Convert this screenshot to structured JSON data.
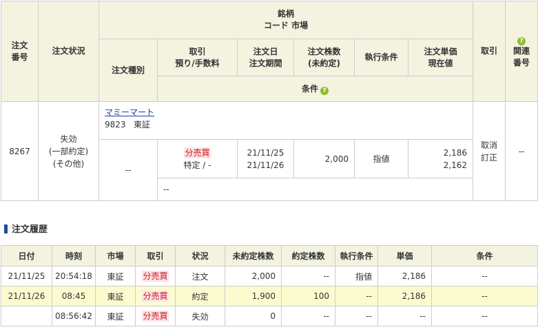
{
  "order": {
    "headers": {
      "order_no": [
        "注文",
        "番号"
      ],
      "status": "注文状況",
      "stock": "銘柄",
      "code_market": "コード 市場",
      "order_type": "注文種別",
      "trade": [
        "取引",
        "預り/手数料"
      ],
      "date": [
        "注文日",
        "注文期間"
      ],
      "qty": [
        "注文株数",
        "(未約定)"
      ],
      "exec_cond": "執行条件",
      "price": [
        "注文単価",
        "現在値"
      ],
      "action": "取引",
      "related": [
        "関連",
        "番号"
      ],
      "condition": "条件",
      "help": "?"
    },
    "row": {
      "order_no": "8267",
      "status": [
        "失効",
        "(一部約定)",
        "(その他)"
      ],
      "stock_name": "マミーマート",
      "code": "9823",
      "market": "東証",
      "order_type": "--",
      "trade_type": "分売買",
      "account": "特定 / -",
      "order_date": "21/11/25",
      "period": "21/11/26",
      "qty": "2,000",
      "exec_cond": "指値",
      "order_price": "2,186",
      "current_price": "2,162",
      "actions": [
        "取消",
        "訂正"
      ],
      "related": "--",
      "condition": "--"
    }
  },
  "history": {
    "title": "注文履歴",
    "headers": [
      "日付",
      "時刻",
      "市場",
      "取引",
      "状況",
      "未約定株数",
      "約定株数",
      "執行条件",
      "単価",
      "条件"
    ],
    "rows": [
      {
        "date": "21/11/25",
        "time": "20:54:18",
        "market": "東証",
        "trade": "分売買",
        "status": "注文",
        "unfilled": "2,000",
        "filled": "--",
        "exec": "指値",
        "price": "2,186",
        "cond": "--"
      },
      {
        "date": "21/11/26",
        "time": "08:45",
        "market": "東証",
        "trade": "分売買",
        "status": "約定",
        "unfilled": "1,900",
        "filled": "100",
        "exec": "--",
        "price": "2,186",
        "cond": "--"
      },
      {
        "date": "",
        "time": "08:56:42",
        "market": "東証",
        "trade": "分売買",
        "status": "失効",
        "unfilled": "0",
        "filled": "--",
        "exec": "--",
        "price": "--",
        "cond": "--"
      }
    ]
  },
  "colors": {
    "header_bg": "#f4f3e0",
    "highlight_row": "#fcfbcf",
    "trade_tag_bg": "#fde3e5",
    "trade_tag_text": "#c8141e",
    "help_icon": "#8bbd2a",
    "section_bar": "#1e4e9a"
  }
}
